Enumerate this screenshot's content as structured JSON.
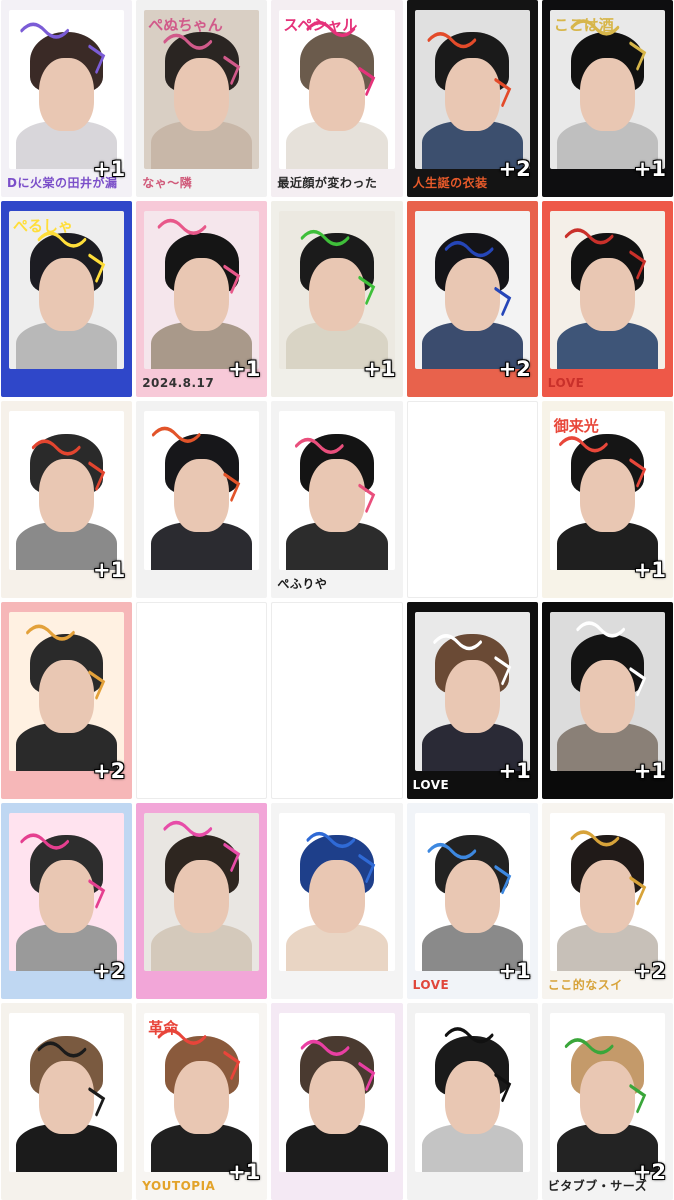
{
  "cards": [
    {
      "count": "+1",
      "caption": "Dに火棠の田井が漏",
      "label": "",
      "bg": "#f3f1f6",
      "frame": "#ffffff",
      "accent": "#7b5cd6",
      "hair": "#3a2a26",
      "body": "#d8d6da",
      "cap_color": "#7b4fc9"
    },
    {
      "count": "",
      "caption": "なゃ〜隣",
      "label": "ぺぬちゃん",
      "bg": "#f1f1f1",
      "frame": "#d9cfc4",
      "accent": "#d15a8a",
      "hair": "#2a2522",
      "body": "#c8b7a8",
      "cap_color": "#d05a7a"
    },
    {
      "count": "",
      "caption": "最近顔が変わった",
      "label": "スペシャル",
      "bg": "#f4eef2",
      "frame": "#ffffff",
      "accent": "#e5327a",
      "hair": "#6b5b4c",
      "body": "#e6e1da",
      "cap_color": "#2a2a2a"
    },
    {
      "count": "+2",
      "caption": "人生誕の衣装",
      "label": "",
      "bg": "#141414",
      "frame": "#e0e0e0",
      "accent": "#e34b2a",
      "hair": "#1a1a1a",
      "body": "#3c4f6e",
      "cap_color": "#e85a2a"
    },
    {
      "count": "+1",
      "caption": "",
      "label": "ここは酒",
      "bg": "#0e0e10",
      "frame": "#e9e9e9",
      "accent": "#d7b64a",
      "hair": "#111111",
      "body": "#bfbfbf",
      "cap_color": "#d7b64a"
    },
    {
      "count": "",
      "caption": "",
      "label": "ぺるしゃ",
      "bg": "#2f47c9",
      "frame": "#eeeeee",
      "accent": "#ffde3a",
      "hair": "#1c1c22",
      "body": "#b8b8b8",
      "cap_color": "#ffffff"
    },
    {
      "count": "+1",
      "caption": "2024.8.17",
      "label": "",
      "bg": "#f7c9d8",
      "frame": "#f5e6ec",
      "accent": "#e8588a",
      "hair": "#151515",
      "body": "#a9998a",
      "cap_color": "#333333"
    },
    {
      "count": "+1",
      "caption": "",
      "label": "",
      "bg": "#f0efe9",
      "frame": "#ece9e1",
      "accent": "#3fbf3a",
      "hair": "#1b1b1b",
      "body": "#d9d4c5",
      "cap_color": "#2b8b2b"
    },
    {
      "count": "+2",
      "caption": "",
      "label": "",
      "bg": "#e8624c",
      "frame": "#f3f3f3",
      "accent": "#2546b8",
      "hair": "#141418",
      "body": "#3b4c6e",
      "cap_color": "#ffffff"
    },
    {
      "count": "",
      "caption": "LOVE",
      "label": "",
      "bg": "#ee5848",
      "frame": "#f4efe8",
      "accent": "#c9302a",
      "hair": "#121212",
      "body": "#3e5578",
      "cap_color": "#c9302a"
    },
    {
      "count": "+1",
      "caption": "",
      "label": "",
      "bg": "#f6f1ea",
      "frame": "#ffffff",
      "accent": "#e3452f",
      "hair": "#2a2a2a",
      "body": "#8a8a8a",
      "cap_color": "#e3452f"
    },
    {
      "count": "",
      "caption": "",
      "label": "",
      "bg": "#f2f2f2",
      "frame": "#ffffff",
      "accent": "#e2542a",
      "hair": "#17171a",
      "body": "#2b2b30",
      "cap_color": "#e2542a"
    },
    {
      "count": "",
      "caption": "ぺふりや",
      "label": "",
      "bg": "#f3f3f3",
      "frame": "#ffffff",
      "accent": "#e94f7c",
      "hair": "#141414",
      "body": "#2c2c2c",
      "cap_color": "#1b1b1b"
    },
    {
      "count": "",
      "caption": "",
      "label": "",
      "blank": true
    },
    {
      "count": "+1",
      "caption": "",
      "label": "御来光",
      "bg": "#f7f3e8",
      "frame": "#ffffff",
      "accent": "#e8473a",
      "hair": "#151515",
      "body": "#1f1f1f",
      "cap_color": "#e8473a"
    },
    {
      "count": "+2",
      "caption": "",
      "label": "",
      "bg": "#f6b7b8",
      "frame": "#fff1e2",
      "accent": "#e3a13a",
      "hair": "#2a2a2a",
      "body": "#2a2a2a",
      "cap_color": "#d63a3a"
    },
    {
      "count": "",
      "caption": "",
      "label": "",
      "blank": true
    },
    {
      "count": "",
      "caption": "",
      "label": "",
      "blank": true
    },
    {
      "count": "+1",
      "caption": "LOVE",
      "label": "",
      "bg": "#0f0f0f",
      "frame": "#e9e9e9",
      "accent": "#ffffff",
      "hair": "#6a4a35",
      "body": "#2a2a36",
      "cap_color": "#ffffff"
    },
    {
      "count": "+1",
      "caption": "",
      "label": "",
      "bg": "#0a0a0a",
      "frame": "#dcdcdc",
      "accent": "#ffffff",
      "hair": "#141414",
      "body": "#8a8077",
      "cap_color": "#ffffff"
    },
    {
      "count": "+2",
      "caption": "",
      "label": "",
      "bg": "#bfd7f2",
      "frame": "#ffe3ef",
      "accent": "#e53f8f",
      "hair": "#2d2d2d",
      "body": "#9a9a9a",
      "cap_color": "#e53f8f"
    },
    {
      "count": "",
      "caption": "",
      "label": "",
      "bg": "#f2a6d8",
      "frame": "#e9e6e2",
      "accent": "#e74ca8",
      "hair": "#2e2620",
      "body": "#d4c9bb",
      "cap_color": "#e74ca8"
    },
    {
      "count": "",
      "caption": "",
      "label": "",
      "bg": "#f4f4f4",
      "frame": "#ffffff",
      "accent": "#2f6ad6",
      "hair": "#1e3f8a",
      "body": "#e9d5c4",
      "cap_color": "#2c8a2c"
    },
    {
      "count": "+1",
      "caption": "LOVE",
      "label": "",
      "bg": "#f1f4f8",
      "frame": "#ffffff",
      "accent": "#3d88e0",
      "hair": "#222222",
      "body": "#8a8a8a",
      "cap_color": "#e0463a"
    },
    {
      "count": "+2",
      "caption": "ここ的なスイ",
      "label": "",
      "bg": "#f7f4ef",
      "frame": "#ffffff",
      "accent": "#d7a33a",
      "hair": "#201a18",
      "body": "#c7c0b8",
      "cap_color": "#d7a33a"
    },
    {
      "count": "",
      "caption": "",
      "label": "",
      "bg": "#f5f2ec",
      "frame": "#ffffff",
      "accent": "#1b1b1b",
      "hair": "#7a5a40",
      "body": "#1b1b1b",
      "cap_color": "#f5d13a"
    },
    {
      "count": "+1",
      "caption": "YOUTOPIA",
      "label": "革命",
      "bg": "#f7f5f2",
      "frame": "#ffffff",
      "accent": "#e8453a",
      "hair": "#8a5a3c",
      "body": "#202020",
      "cap_color": "#e3a32a"
    },
    {
      "count": "",
      "caption": "",
      "label": "",
      "bg": "#f4e9f4",
      "frame": "#ffffff",
      "accent": "#e93fa3",
      "hair": "#4a3a30",
      "body": "#1c1c1c",
      "cap_color": "#e93fa3"
    },
    {
      "count": "",
      "caption": "",
      "label": "",
      "bg": "#f2f2f2",
      "frame": "#ffffff",
      "accent": "#111111",
      "hair": "#1a1a1a",
      "body": "#c4c4c4",
      "cap_color": "#111111"
    },
    {
      "count": "+2",
      "caption": "ビタブブ・サーズ",
      "label": "",
      "bg": "#f3f3f3",
      "frame": "#ffffff",
      "accent": "#3aa63a",
      "hair": "#c49a6a",
      "body": "#232323",
      "cap_color": "#222222"
    }
  ]
}
